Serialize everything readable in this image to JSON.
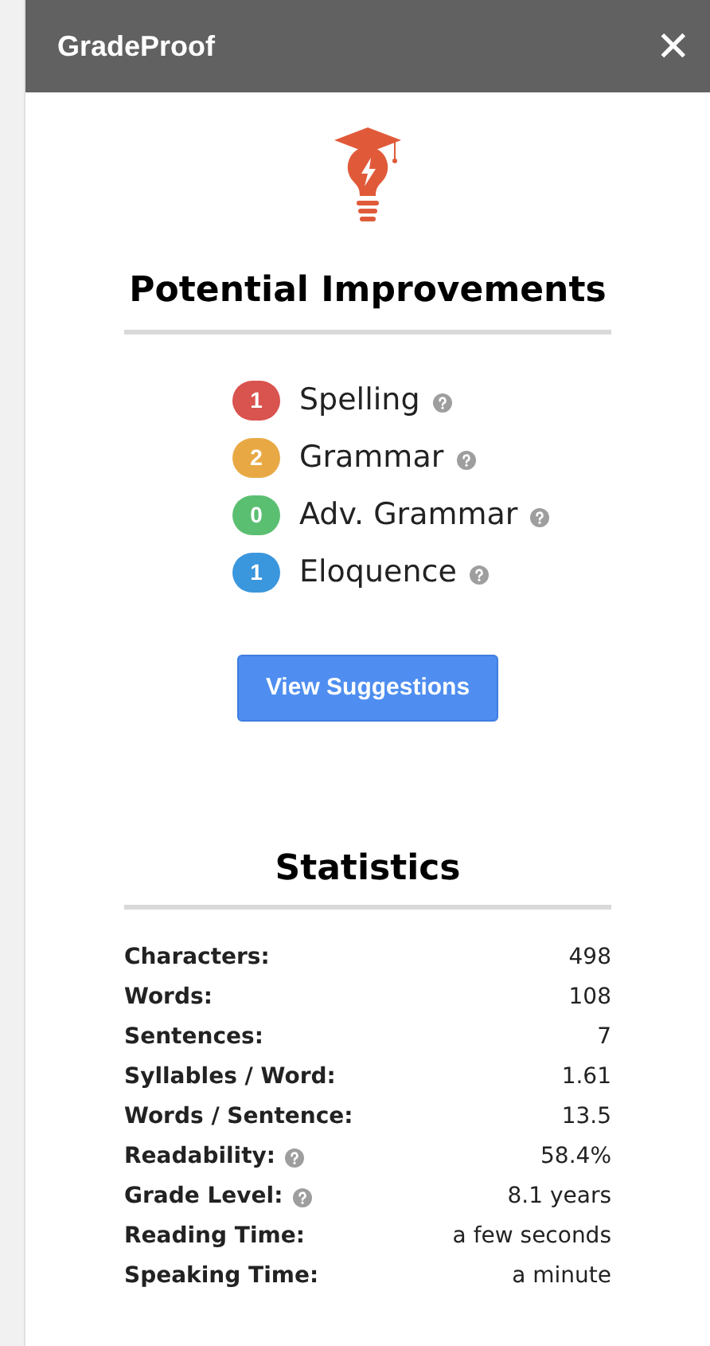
{
  "header": {
    "title": "GradeProof",
    "close": "✕"
  },
  "improvements": {
    "title": "Potential Improvements",
    "items": [
      {
        "count": "1",
        "label": "Spelling",
        "color": "#d9534f",
        "help": true
      },
      {
        "count": "2",
        "label": "Grammar",
        "color": "#e8a945",
        "help": true
      },
      {
        "count": "0",
        "label": "Adv. Grammar",
        "color": "#5bbf72",
        "help": true
      },
      {
        "count": "1",
        "label": "Eloquence",
        "color": "#3a96dd",
        "help": true
      }
    ],
    "button": "View Suggestions"
  },
  "statistics": {
    "title": "Statistics",
    "rows": [
      {
        "label": "Characters:",
        "value": "498",
        "help": false
      },
      {
        "label": "Words:",
        "value": "108",
        "help": false
      },
      {
        "label": "Sentences:",
        "value": "7",
        "help": false
      },
      {
        "label": "Syllables / Word:",
        "value": "1.61",
        "help": false
      },
      {
        "label": "Words / Sentence:",
        "value": "13.5",
        "help": false
      },
      {
        "label": "Readability:",
        "value": "58.4%",
        "help": true
      },
      {
        "label": "Grade Level:",
        "value": "8.1 years",
        "help": true
      },
      {
        "label": "Reading Time:",
        "value": "a few seconds",
        "help": false
      },
      {
        "label": "Speaking Time:",
        "value": "a minute",
        "help": false
      }
    ]
  }
}
